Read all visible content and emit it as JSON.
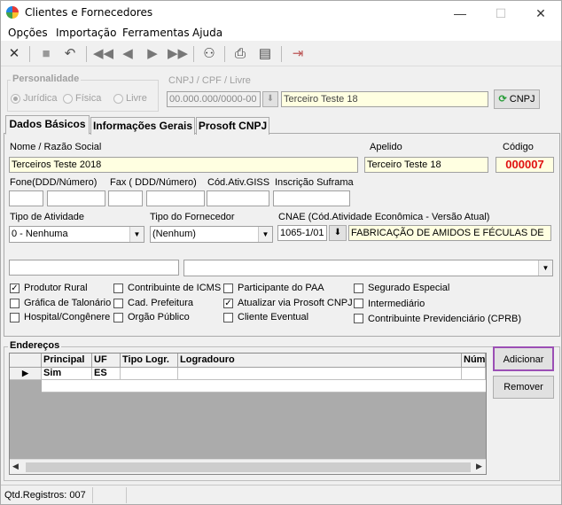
{
  "window": {
    "title": "Clientes e Fornecedores",
    "minimize": "—",
    "maximize": "☐",
    "close": "✕"
  },
  "menu": [
    "Opções",
    "Importação",
    "Ferramentas",
    "Ajuda"
  ],
  "personalidade": {
    "label": "Personalidade",
    "options": [
      "Jurídica",
      "Física",
      "Livre"
    ],
    "selected": "Jurídica"
  },
  "cnpj": {
    "label": "CNPJ / CPF / Livre",
    "value": "00.000.000/0000-00",
    "name_value": "Terceiro Teste 18",
    "button": "CNPJ"
  },
  "tabs": [
    "Dados Básicos",
    "Informações Gerais",
    "Prosoft CNPJ"
  ],
  "dados": {
    "nome_label": "Nome / Razão Social",
    "nome_value": "Terceiros Teste 2018",
    "apelido_label": "Apelido",
    "apelido_value": "Terceiro Teste 18",
    "codigo_label": "Código",
    "codigo_value": "000007",
    "fone_label": "Fone(DDD/Número)",
    "fax_label": "Fax ( DDD/Número)",
    "giss_label": "Cód.Ativ.GISS",
    "suframa_label": "Inscrição Suframa",
    "atividade_label": "Tipo de Atividade",
    "atividade_value": "0 - Nenhuma",
    "fornecedor_label": "Tipo do Fornecedor",
    "fornecedor_value": "(Nenhum)",
    "cnae_label": "CNAE (Cód.Atividade Econômica - Versão Atual)",
    "cnae_code": "1065-1/01",
    "cnae_desc": "FABRICAÇÃO DE AMIDOS E FÉCULAS DE"
  },
  "checks": [
    {
      "label": "Produtor Rural",
      "checked": true
    },
    {
      "label": "Gráfica de Talonário",
      "checked": false
    },
    {
      "label": "Hospital/Congênere",
      "checked": false
    },
    {
      "label": "Contribuinte de ICMS",
      "checked": false
    },
    {
      "label": "Cad. Prefeitura",
      "checked": false
    },
    {
      "label": "Orgão Público",
      "checked": false
    },
    {
      "label": "Participante do PAA",
      "checked": false
    },
    {
      "label": "Atualizar via Prosoft CNPJ",
      "checked": true
    },
    {
      "label": "Cliente Eventual",
      "checked": false
    },
    {
      "label": "Segurado Especial",
      "checked": false
    },
    {
      "label": "Intermediário",
      "checked": false
    },
    {
      "label": "Contribuinte Previdenciário (CPRB)",
      "checked": false
    }
  ],
  "enderecos": {
    "label": "Endereços",
    "columns": [
      "Principal",
      "UF",
      "Tipo Logr.",
      "Logradouro",
      "Núme"
    ],
    "rows": [
      [
        "Sim",
        "ES",
        "",
        ""
      ]
    ],
    "add_button": "Adicionar",
    "remove_button": "Remover"
  },
  "status": "Qtd.Registros: 007"
}
